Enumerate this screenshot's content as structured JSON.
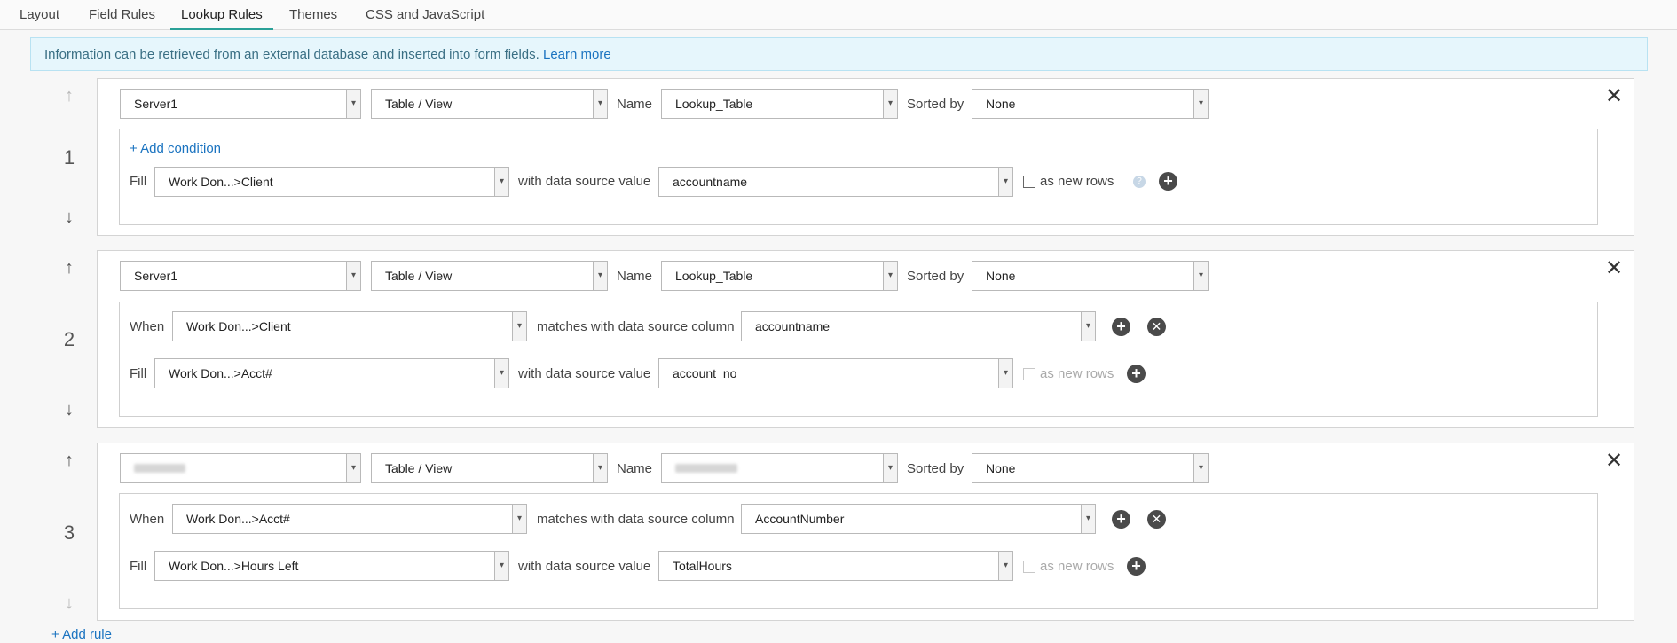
{
  "tabs": [
    {
      "label": "Layout"
    },
    {
      "label": "Field Rules"
    },
    {
      "label": "Lookup Rules"
    },
    {
      "label": "Themes"
    },
    {
      "label": "CSS and JavaScript"
    }
  ],
  "info": {
    "text": "Information can be retrieved from an external database and inserted into form fields.",
    "link": "Learn more"
  },
  "labels": {
    "name": "Name",
    "sorted_by": "Sorted by",
    "fill": "Fill",
    "when": "When",
    "with_value": "with data source value",
    "matches": "matches with data source column",
    "as_new_rows": "as new rows",
    "add_condition": "+ Add condition",
    "add_rule": "+ Add rule"
  },
  "rules": [
    {
      "number": "1",
      "server": "Server1",
      "source_type": "Table / View",
      "name": "Lookup_Table",
      "sorted_by": "None",
      "fill_field": "Work Don...>Client",
      "fill_value": "accountname"
    },
    {
      "number": "2",
      "server": "Server1",
      "source_type": "Table / View",
      "name": "Lookup_Table",
      "sorted_by": "None",
      "when_field": "Work Don...>Client",
      "when_column": "accountname",
      "fill_field": "Work Don...>Acct#",
      "fill_value": "account_no"
    },
    {
      "number": "3",
      "server": "",
      "source_type": "Table / View",
      "name": "",
      "sorted_by": "None",
      "when_field": "Work Don...>Acct#",
      "when_column": "AccountNumber",
      "fill_field": "Work Don...>Hours Left",
      "fill_value": "TotalHours"
    }
  ],
  "icons": {
    "arrow_up": "arrow-up-icon",
    "arrow_down": "arrow-down-icon",
    "close": "close-icon",
    "add": "plus-circle-icon",
    "remove": "x-circle-icon",
    "help": "help-icon",
    "dropdown": "chevron-down-icon"
  },
  "colors": {
    "accent": "#2aa198",
    "link": "#1a73c0",
    "info_bg": "#e6f6fc"
  }
}
